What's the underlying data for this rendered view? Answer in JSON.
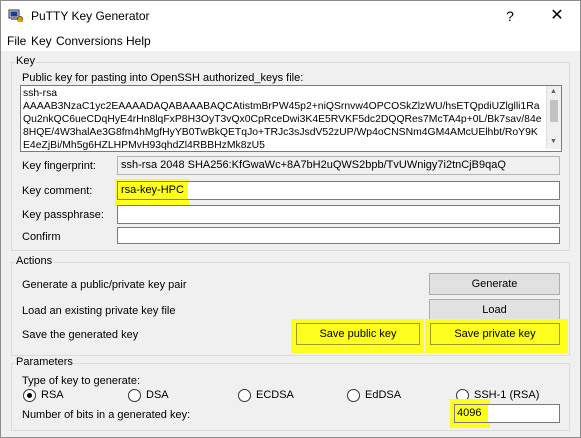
{
  "window": {
    "title": "PuTTY Key Generator",
    "help_glyph": "?",
    "close_glyph": "✕",
    "icon": "putty-keygen-icon"
  },
  "menu": [
    "File",
    "Key",
    "Conversions",
    "Help"
  ],
  "key_section": {
    "title": "Key",
    "public_key_label": "Public key for pasting into OpenSSH authorized_keys file:",
    "public_key_text": "ssh-rsa\nAAAAB3NzaC1yc2EAAAADAQABAAABAQCAtistmBrPW45p2+niQSrnvw4OPCOSkZlzWU/hsETQpdiUZlglli1RaQu2nkQC6ueCDqHyE4rHn8lqFxP8H3OyT3vQx0CpRceDwi3K4E5RVKF5dc2DQQRes7McTA4p+0L/Bk7sav/84e8HQE/4W3halAe3G8fm4hMgfHyYB0TwBkQETqJo+TRJc3sJsdV52zUP/Wp4oCNSNm4GM4AMcUElhbt/RoY9KE4eZjBi/Mh5g6HZLHPMvH93qhdZl4RBBHzMk8zU5",
    "fingerprint_label": "Key fingerprint:",
    "fingerprint_value": "ssh-rsa 2048 SHA256:KfGwaWc+8A7bH2uQWS2bpb/TvUWnigy7i2tnCjB9qaQ",
    "comment_label": "Key comment:",
    "comment_value": "rsa-key-HPC",
    "passphrase_label": "Key passphrase:",
    "passphrase_value": "",
    "confirm_label": "Confirm",
    "confirm_value": ""
  },
  "actions": {
    "title": "Actions",
    "generate_label": "Generate a public/private key pair",
    "generate_button": "Generate",
    "load_label": "Load an existing private key file",
    "load_button": "Load",
    "save_label": "Save the generated key",
    "save_public_button": "Save public key",
    "save_private_button": "Save private key"
  },
  "parameters": {
    "title": "Parameters",
    "key_type_label": "Type of key to generate:",
    "key_types": [
      {
        "label": "RSA",
        "selected": true
      },
      {
        "label": "DSA",
        "selected": false
      },
      {
        "label": "ECDSA",
        "selected": false
      },
      {
        "label": "EdDSA",
        "selected": false
      },
      {
        "label": "SSH-1 (RSA)",
        "selected": false
      }
    ],
    "bits_label": "Number of bits in a generated key:",
    "bits_value": "4096"
  },
  "colors": {
    "highlight": "#ffff1e",
    "window_bg": "#f0f0f0"
  }
}
